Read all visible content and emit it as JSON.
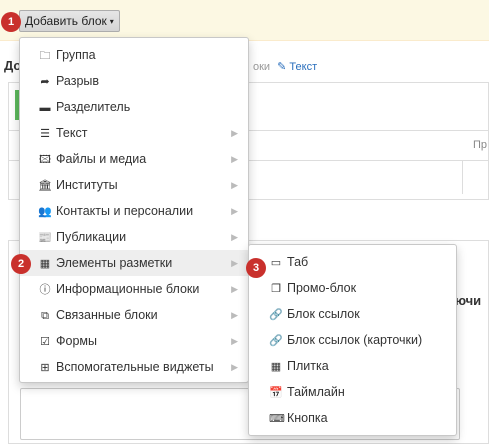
{
  "toolbar": {
    "add_block_label": "Добавить блок",
    "caret": "▾"
  },
  "badges": {
    "b1": "1",
    "b2": "2",
    "b3": "3"
  },
  "background": {
    "heading": "До",
    "links_prefix": "оки",
    "text_link_icon": "✎",
    "text_link": "Текст",
    "column_pr": "Пр",
    "keys_label": "ючи"
  },
  "menu": {
    "items": [
      {
        "icon": "folder-icon",
        "glyph": "🗀",
        "label": "Группа",
        "submenu": false
      },
      {
        "icon": "share-icon",
        "glyph": "➦",
        "label": "Разрыв",
        "submenu": false
      },
      {
        "icon": "minus-icon",
        "glyph": "▬",
        "label": "Разделитель",
        "submenu": false
      },
      {
        "icon": "align-left-icon",
        "glyph": "☰",
        "label": "Текст",
        "submenu": true
      },
      {
        "icon": "picture-icon",
        "glyph": "🖾",
        "label": "Файлы и медиа",
        "submenu": true
      },
      {
        "icon": "institution-icon",
        "glyph": "🏛",
        "label": "Институты",
        "submenu": true
      },
      {
        "icon": "users-icon",
        "glyph": "👥",
        "label": "Контакты и персоналии",
        "submenu": true
      },
      {
        "icon": "newspaper-icon",
        "glyph": "📰",
        "label": "Публикации",
        "submenu": true
      },
      {
        "icon": "th-icon",
        "glyph": "▦",
        "label": "Элементы разметки",
        "submenu": true,
        "active": true
      },
      {
        "icon": "info-circle-icon",
        "glyph": "ⓘ",
        "label": "Информационные блоки",
        "submenu": true
      },
      {
        "icon": "external-link-square-icon",
        "glyph": "⧉",
        "label": "Связанные блоки",
        "submenu": true
      },
      {
        "icon": "check-square-icon",
        "glyph": "☑",
        "label": "Формы",
        "submenu": true
      },
      {
        "icon": "plus-square-icon",
        "glyph": "⊞",
        "label": "Вспомогательные виджеты",
        "submenu": true
      }
    ]
  },
  "submenu": {
    "items": [
      {
        "icon": "window-icon",
        "glyph": "▭",
        "label": "Таб"
      },
      {
        "icon": "clone-icon",
        "glyph": "❐",
        "label": "Промо-блок"
      },
      {
        "icon": "link-icon",
        "glyph": "🔗",
        "label": "Блок ссылок"
      },
      {
        "icon": "link-icon",
        "glyph": "🔗",
        "label": "Блок ссылок (карточки)"
      },
      {
        "icon": "th-large-icon",
        "glyph": "▦",
        "label": "Плитка"
      },
      {
        "icon": "calendar-icon",
        "glyph": "📅",
        "label": "Таймлайн"
      },
      {
        "icon": "keyboard-icon",
        "glyph": "⌨",
        "label": "Кнопка"
      }
    ]
  },
  "colors": {
    "badge": "#c9302c",
    "topbar": "#fcf8e3",
    "active_item": "#eeeeee",
    "link": "#2a6fbd",
    "success": "#5cb85c"
  }
}
